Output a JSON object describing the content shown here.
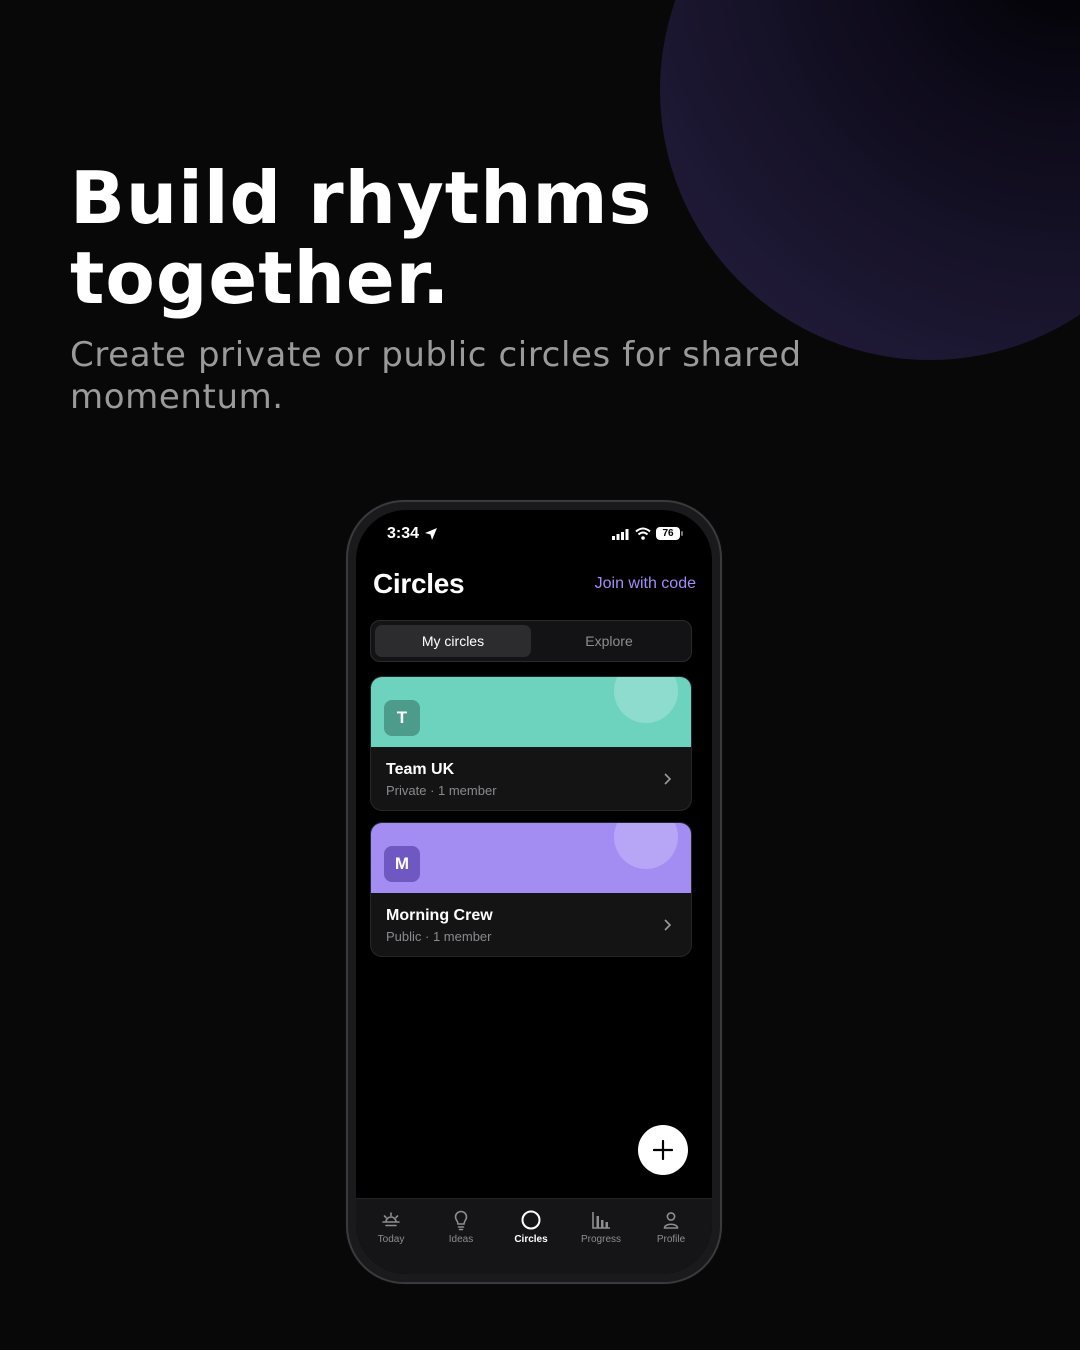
{
  "hero": {
    "headline_line1": "Build rhythms",
    "headline_line2": "together.",
    "subheadline": "Create private or public circles for shared momentum."
  },
  "status_bar": {
    "time": "3:34",
    "battery": "76"
  },
  "header": {
    "title": "Circles",
    "join_label": "Join with code"
  },
  "segmented": {
    "options": [
      {
        "label": "My circles",
        "selected": true
      },
      {
        "label": "Explore",
        "selected": false
      }
    ]
  },
  "circles": [
    {
      "initial": "T",
      "name": "Team UK",
      "meta": "Private · 1 member",
      "banner_color": "#6dd3bf",
      "avatar_color": "#4c9b8b"
    },
    {
      "initial": "M",
      "name": "Morning Crew",
      "meta": "Public · 1 member",
      "banner_color": "#a38cf2",
      "avatar_color": "#7058c2"
    }
  ],
  "fab": {
    "icon": "plus-icon"
  },
  "tabbar": {
    "items": [
      {
        "label": "Today",
        "icon": "sunrise-icon",
        "active": false
      },
      {
        "label": "Ideas",
        "icon": "lightbulb-icon",
        "active": false
      },
      {
        "label": "Circles",
        "icon": "circle-icon",
        "active": true
      },
      {
        "label": "Progress",
        "icon": "bar-chart-icon",
        "active": false
      },
      {
        "label": "Profile",
        "icon": "person-icon",
        "active": false
      }
    ]
  },
  "colors": {
    "accent": "#a38cf5",
    "background": "#080808",
    "decor_circle": "#221c3b"
  }
}
